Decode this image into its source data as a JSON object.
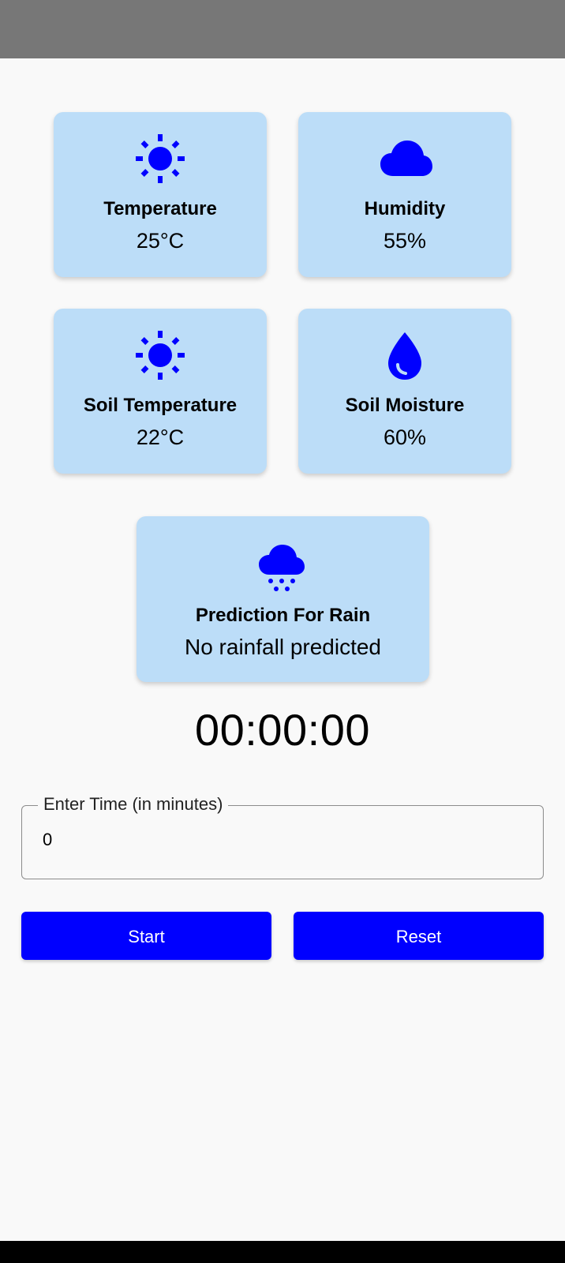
{
  "colors": {
    "accent": "#0000ff",
    "card_background": "#bcddf8",
    "page_background": "#f9f9f9",
    "status_bar": "#777777"
  },
  "cards": [
    {
      "icon": "sun-icon",
      "label": "Temperature",
      "value": "25°C"
    },
    {
      "icon": "cloud-icon",
      "label": "Humidity",
      "value": "55%"
    },
    {
      "icon": "sun-icon",
      "label": "Soil Temperature",
      "value": "22°C"
    },
    {
      "icon": "water-drop-icon",
      "label": "Soil Moisture",
      "value": "60%"
    }
  ],
  "rain_card": {
    "icon": "rain-cloud-icon",
    "label": "Prediction For Rain",
    "value": "No rainfall predicted"
  },
  "timer": {
    "display": "00:00:00"
  },
  "time_input": {
    "label": "Enter Time (in minutes)",
    "value": "0"
  },
  "buttons": {
    "start_label": "Start",
    "reset_label": "Reset"
  }
}
